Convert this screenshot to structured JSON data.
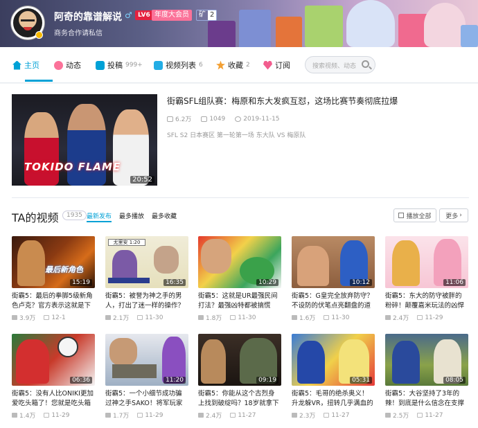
{
  "user": {
    "name": "阿奇的靠谱解说",
    "gender_symbol": "♂",
    "level": "LV6",
    "vip": "年度大会员",
    "mine_label": "矿",
    "mine_count": "2",
    "sign": "商务合作请私信"
  },
  "nav": {
    "home": "主页",
    "dynamic": "动态",
    "uploads": "投稿",
    "uploads_count": "999+",
    "playlist": "视频列表",
    "playlist_count": "6",
    "favorites": "收藏",
    "favorites_count": "2",
    "subscribe": "订阅",
    "search_placeholder": "搜索视频、动态"
  },
  "featured": {
    "title": "街霸SFL组队赛：梅原和东大发疯互怼，这场比赛节奏彻底拉爆",
    "plays": "6.2万",
    "comments": "1049",
    "date": "2019-11-15",
    "desc": "SFL S2 日本赛区 第一轮第一场 东大队 VS 梅原队",
    "duration": "20:52",
    "thumb_text": "TOKIDO FLAME"
  },
  "section": {
    "title": "TA的视频",
    "count": "1935",
    "sort_latest": "最新发布",
    "sort_plays": "最多播放",
    "sort_favs": "最多收藏",
    "play_all": "播放全部",
    "more": "更多"
  },
  "videos": [
    {
      "title": "街霸5：最后的拳脚5级新角色卢克？官方表示这就是下一代",
      "duration": "15:19",
      "plays": "3.9万",
      "date": "12-1"
    },
    {
      "title": "街霸5：被誉为神之手的男人，打出了迷一样的操作？这",
      "duration": "16:35",
      "plays": "2.1万",
      "date": "11-30"
    },
    {
      "title": "街霸5：这就是UR最强民间打法？最强凶特都被搞慌了！",
      "duration": "10:29",
      "plays": "1.8万",
      "date": "11-30"
    },
    {
      "title": "街霸5：G皇完全放弃防守？不设防的伏笔点亮翻盘的道路！",
      "duration": "10:12",
      "plays": "1.6万",
      "date": "11-30"
    },
    {
      "title": "街霸5：东大的防守被胖的粉碎！颠覆嘉米玩法的凶悍之",
      "duration": "11:06",
      "plays": "2.4万",
      "date": "11-29"
    },
    {
      "title": "街霸5：没有人比ONIKI更加爱吃头箱了！您就是吃头箱第",
      "duration": "06:36",
      "plays": "1.4万",
      "date": "11-29"
    },
    {
      "title": "街霸5：一个小细节成功骗过神之手SAKO！将军玩家中最",
      "duration": "11:20",
      "plays": "1.7万",
      "date": "11-29"
    },
    {
      "title": "街霸5：你能从这个古烈身上找到破绽吗？18岁就拿下古烈",
      "duration": "09:19",
      "plays": "2.4万",
      "date": "11-27"
    },
    {
      "title": "街霸5：毛哥的绝杀奥义！升龙躲VR，扭转几乎满血的血量",
      "duration": "05:31",
      "plays": "2.3万",
      "date": "11-27"
    },
    {
      "title": "街霸5：大谷坚持了3年的辣！到底是什么信念在支撑他用隆",
      "duration": "08:05",
      "plays": "2.5万",
      "date": "11-27"
    }
  ],
  "thumb_texts": {
    "v0": "最后新角色",
    "v1": "尤里安 1:20"
  },
  "colors": {
    "accent": "#00a1d6",
    "pink": "#fb7299",
    "lv_red": "#e5213f"
  }
}
